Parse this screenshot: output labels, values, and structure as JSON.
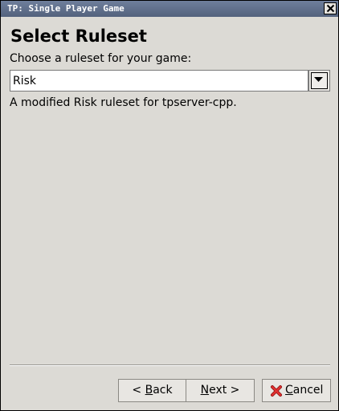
{
  "window": {
    "title": "TP: Single Player Game"
  },
  "page": {
    "heading": "Select Ruleset",
    "prompt": "Choose a ruleset for your game:",
    "ruleset_selected": "Risk",
    "ruleset_description": "A modified Risk ruleset for tpserver-cpp."
  },
  "buttons": {
    "back": {
      "prefix": "< ",
      "mnemonic": "B",
      "rest": "ack"
    },
    "next": {
      "mnemonic": "N",
      "rest": "ext >"
    },
    "cancel": {
      "mnemonic": "C",
      "rest": "ancel"
    }
  },
  "icons": {
    "close": "close-icon",
    "dropdown": "chevron-down-icon",
    "cancel": "cancel-x-icon"
  },
  "colors": {
    "titlebar": "#5f6e8a",
    "background": "#dcdad5",
    "cancel_icon": "#d32020"
  }
}
